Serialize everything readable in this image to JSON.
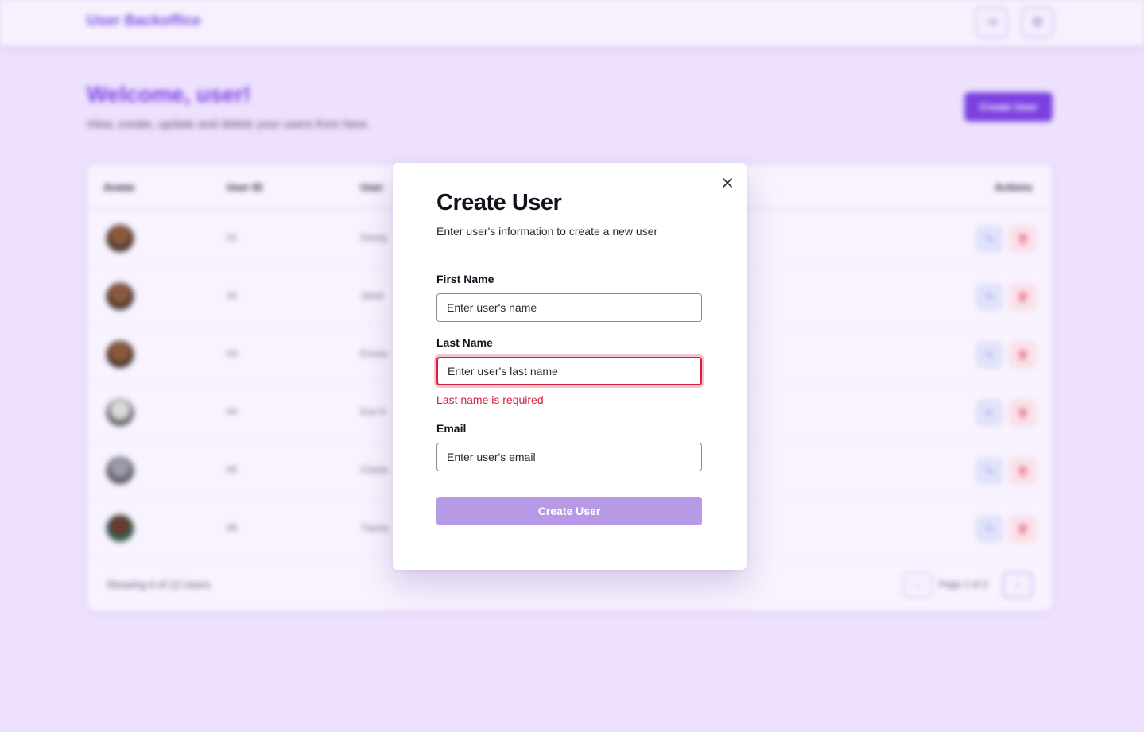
{
  "background": {
    "brand": "User Backoffice",
    "welcome_title": "Welcome, user!",
    "welcome_subtitle": "View, create, update and delete your users from here.",
    "create_button": "Create User",
    "table": {
      "headers": [
        "Avatar",
        "User ID",
        "User",
        "Actions"
      ],
      "rows": [
        {
          "id": "#1",
          "name": "Georg"
        },
        {
          "id": "#2",
          "name": "Janet"
        },
        {
          "id": "#3",
          "name": "Emma"
        },
        {
          "id": "#4",
          "name": "Eve H"
        },
        {
          "id": "#5",
          "name": "Charle"
        },
        {
          "id": "#6",
          "name": "Tracey"
        }
      ],
      "footer_text": "Showing 6 of 12 Users",
      "page_label": "Page 1 of 2"
    },
    "icons": {
      "logout": "logout-icon",
      "settings": "settings-icon",
      "edit": "pencil-icon",
      "delete": "trash-icon",
      "close": "close-icon"
    }
  },
  "modal": {
    "title": "Create User",
    "description": "Enter user's information to create a new user",
    "fields": {
      "first_name": {
        "label": "First Name",
        "placeholder": "Enter user's name",
        "value": ""
      },
      "last_name": {
        "label": "Last Name",
        "placeholder": "Enter user's last name",
        "value": "",
        "error": "Last name is required"
      },
      "email": {
        "label": "Email",
        "placeholder": "Enter user's email",
        "value": ""
      }
    },
    "submit_label": "Create User"
  },
  "colors": {
    "accent": "#7c3fe0",
    "submit_disabled": "#b69ae6",
    "error": "#d5203f",
    "backdrop": "#ede1fd"
  }
}
